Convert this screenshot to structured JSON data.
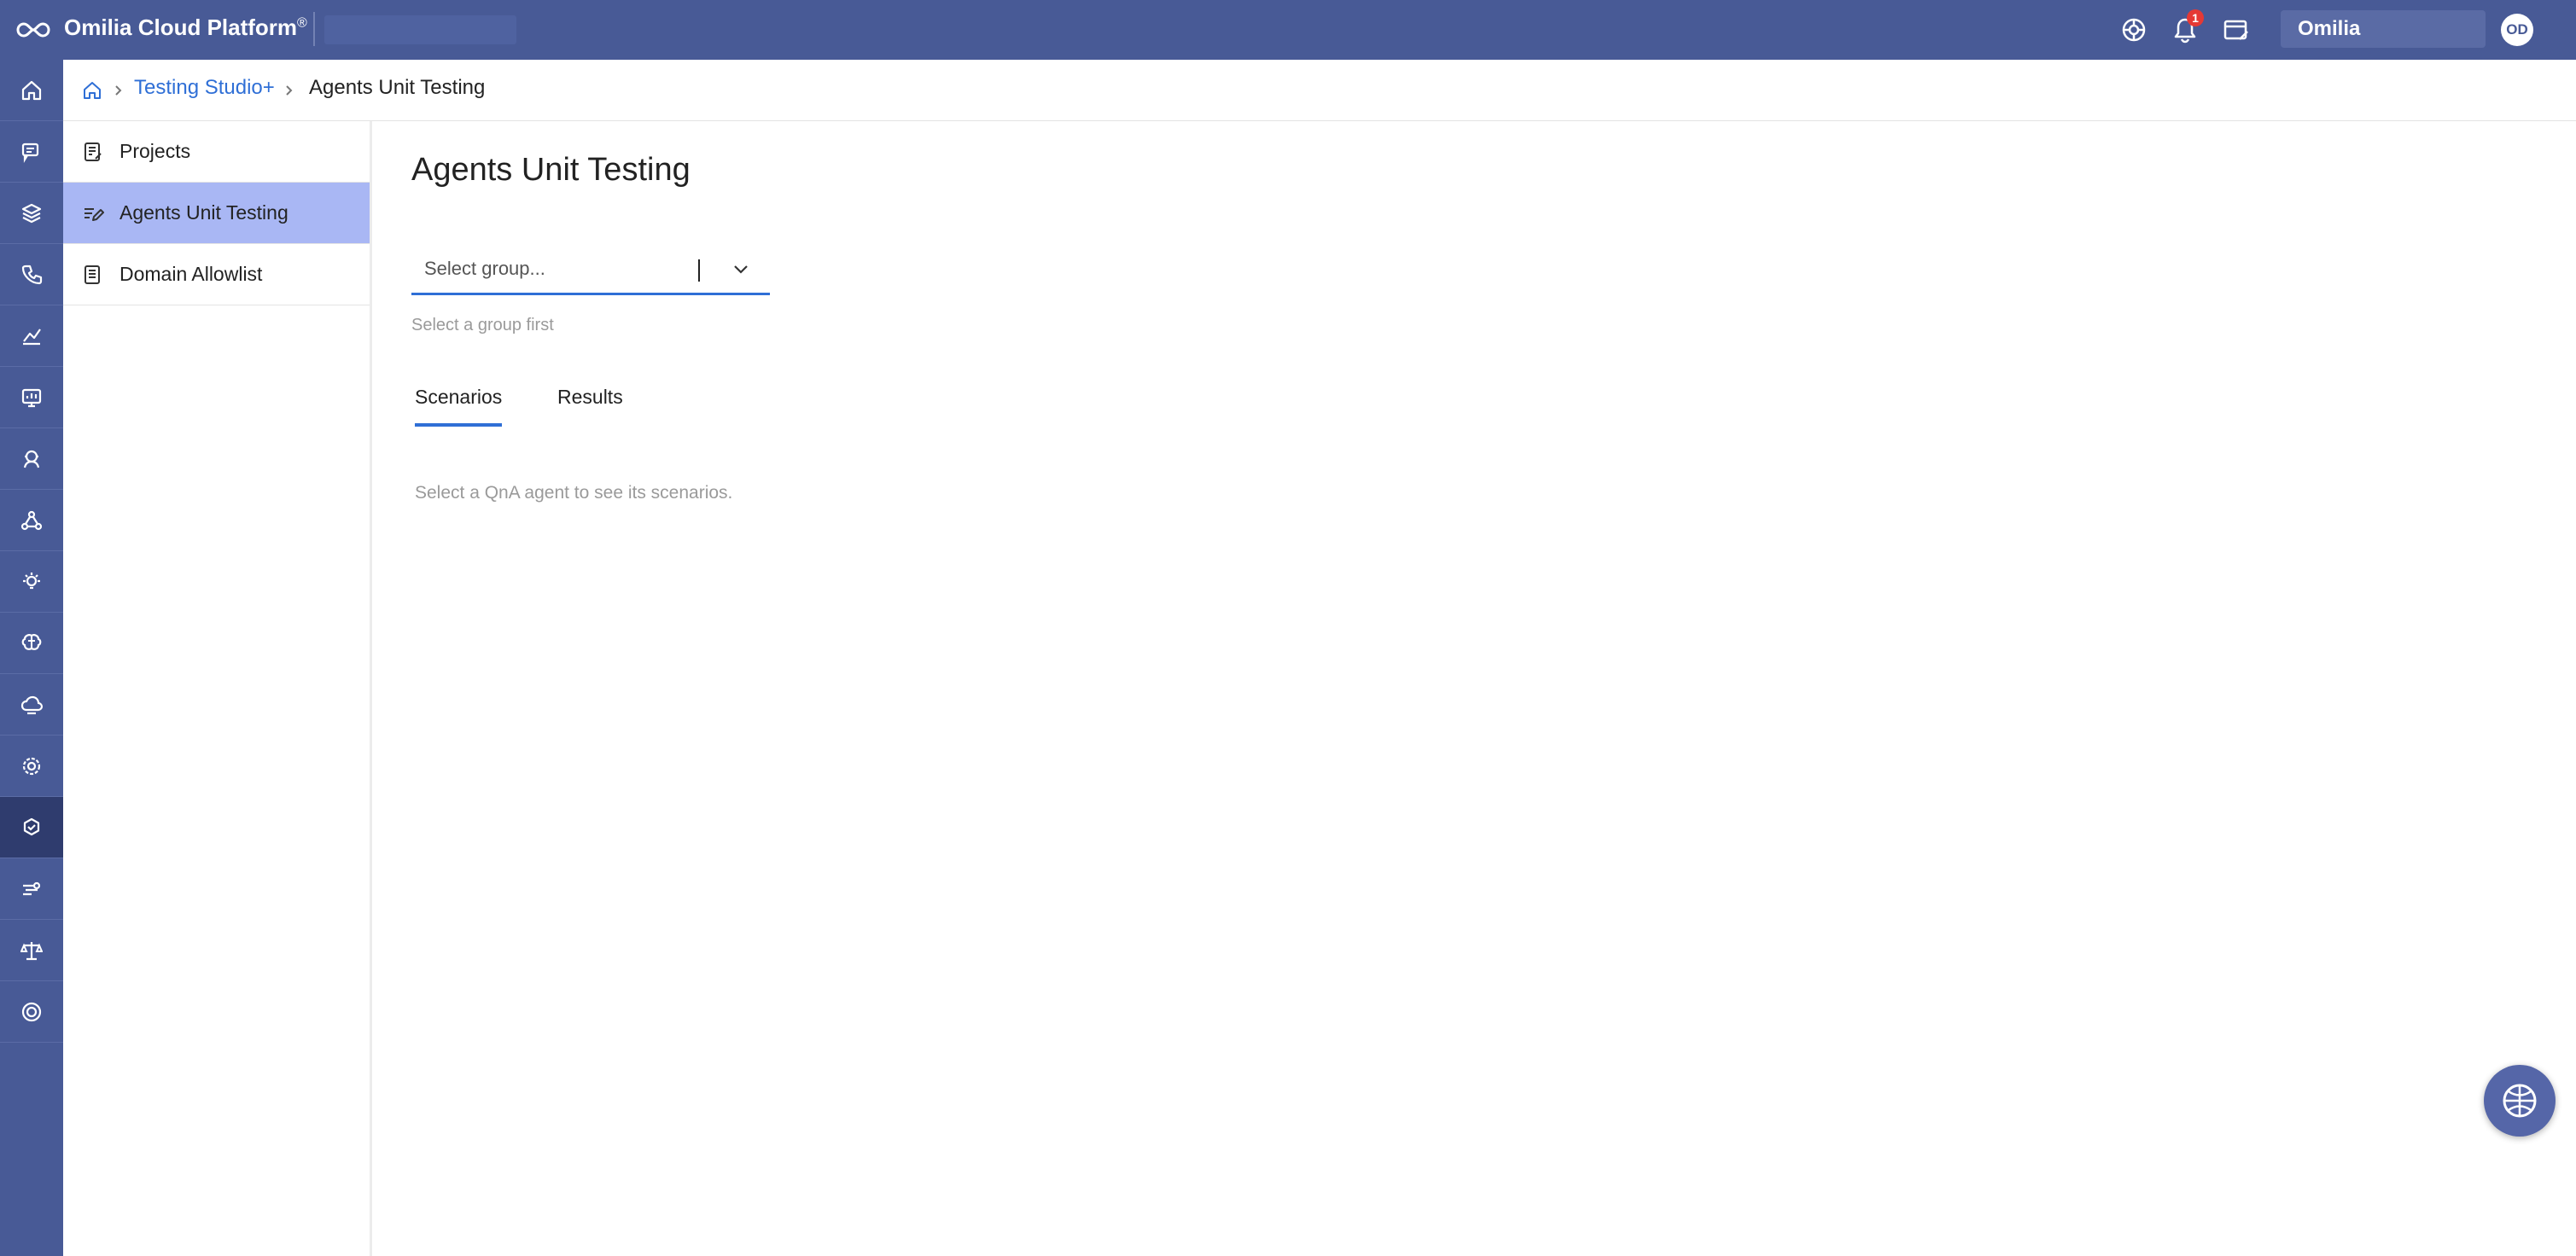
{
  "app": {
    "title": "Omilia Cloud Platform",
    "title_mark": "®",
    "notification_count": "1",
    "organization": "Omilia",
    "user_initials": "OD"
  },
  "breadcrumb": {
    "parent": "Testing Studio+",
    "current": "Agents Unit Testing"
  },
  "rail": {
    "icons": [
      "home-icon",
      "chat-bubble-icon",
      "layers-icon",
      "phone-icon",
      "analytics-icon",
      "monitor-icon",
      "agent-icon",
      "network-icon",
      "lightbulb-icon",
      "brain-icon",
      "cloud-icon",
      "settings-user-icon",
      "testing-gear-icon",
      "speed-icon",
      "scale-icon",
      "support-icon"
    ],
    "active_index": 12
  },
  "subnav": {
    "items": [
      {
        "label": "Projects",
        "icon": "document-edit-icon"
      },
      {
        "label": "Agents Unit Testing",
        "icon": "edit-list-icon"
      },
      {
        "label": "Domain Allowlist",
        "icon": "document-list-icon"
      }
    ],
    "active_index": 1
  },
  "main": {
    "title": "Agents Unit Testing",
    "group_select": {
      "placeholder": "Select group..."
    },
    "helper_text": "Select a group first",
    "tabs": [
      {
        "label": "Scenarios"
      },
      {
        "label": "Results"
      }
    ],
    "active_tab": 0,
    "empty_message": "Select a QnA agent to see its scenarios."
  },
  "colors": {
    "topbar": "#485a96",
    "rail_active": "#2f3c6e",
    "subnav_active": "#a9b7f4",
    "accent": "#2f6fd6",
    "badge": "#e53935"
  }
}
